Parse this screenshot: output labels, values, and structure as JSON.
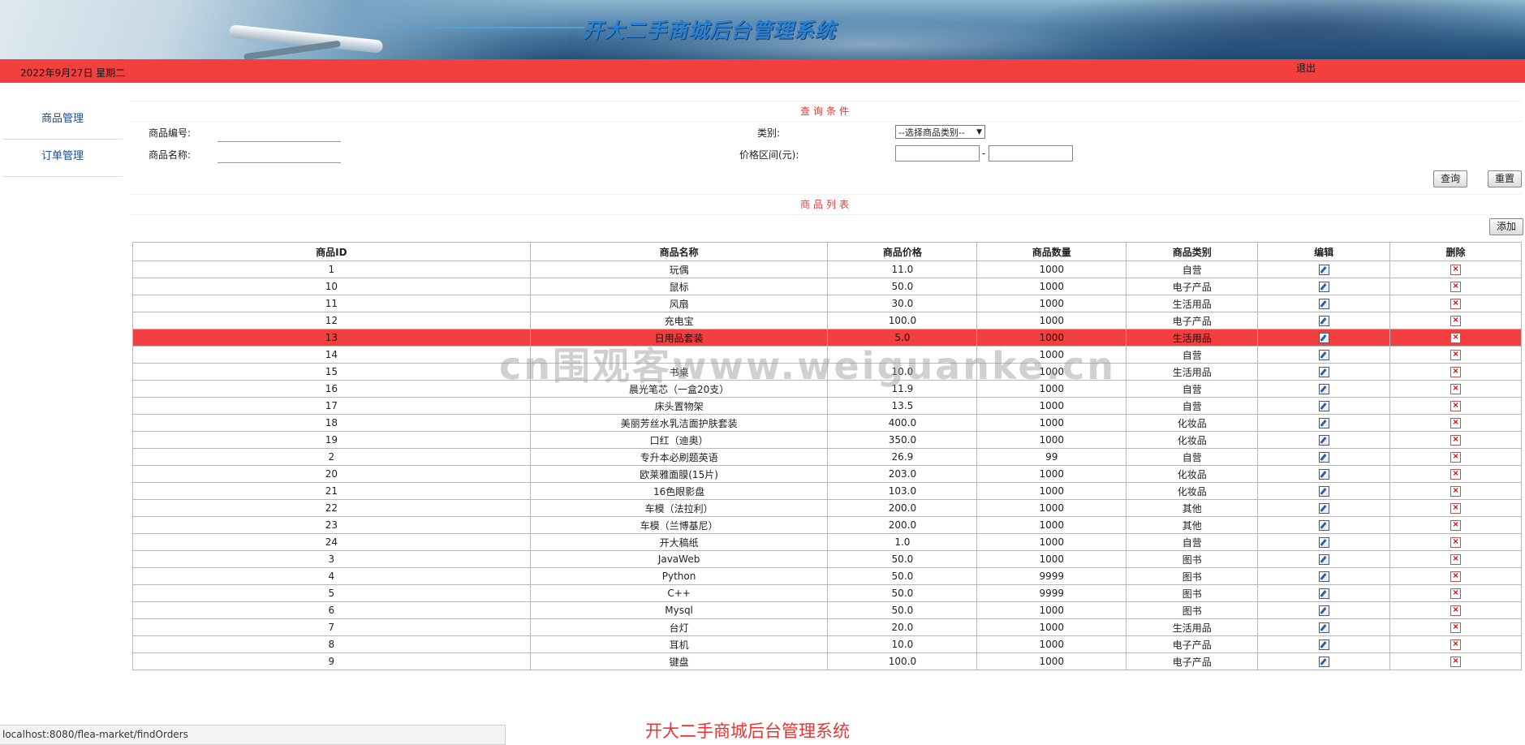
{
  "header": {
    "title": "开大二手商城后台管理系统",
    "date": "2022年9月27日 星期二",
    "logout_label": "退出"
  },
  "sidebar": {
    "items": [
      {
        "label": "商品管理"
      },
      {
        "label": "订单管理"
      }
    ]
  },
  "query": {
    "section_title": "查询条件",
    "id_label": "商品编号:",
    "name_label": "商品名称:",
    "category_label": "类别:",
    "category_selected": "--选择商品类别--",
    "price_label": "价格区间(元):",
    "price_separator": "-",
    "search_label": "查询",
    "reset_label": "重置"
  },
  "list": {
    "section_title": "商品列表",
    "add_label": "添加",
    "columns": [
      "商品ID",
      "商品名称",
      "商品价格",
      "商品数量",
      "商品类别",
      "编辑",
      "删除"
    ],
    "highlighted_row": 4,
    "rows": [
      {
        "id": "1",
        "name": "玩偶",
        "price": "11.0",
        "qty": "1000",
        "category": "自营"
      },
      {
        "id": "10",
        "name": "鼠标",
        "price": "50.0",
        "qty": "1000",
        "category": "电子产品"
      },
      {
        "id": "11",
        "name": "风扇",
        "price": "30.0",
        "qty": "1000",
        "category": "生活用品"
      },
      {
        "id": "12",
        "name": "充电宝",
        "price": "100.0",
        "qty": "1000",
        "category": "电子产品"
      },
      {
        "id": "13",
        "name": "日用品套装",
        "price": "5.0",
        "qty": "1000",
        "category": "生活用品"
      },
      {
        "id": "14",
        "name": "",
        "price": "",
        "qty": "1000",
        "category": "自营"
      },
      {
        "id": "15",
        "name": "书桌",
        "price": "10.0",
        "qty": "1000",
        "category": "生活用品"
      },
      {
        "id": "16",
        "name": "晨光笔芯（一盒20支）",
        "price": "11.9",
        "qty": "1000",
        "category": "自营"
      },
      {
        "id": "17",
        "name": "床头置物架",
        "price": "13.5",
        "qty": "1000",
        "category": "自营"
      },
      {
        "id": "18",
        "name": "美丽芳丝水乳洁面护肤套装",
        "price": "400.0",
        "qty": "1000",
        "category": "化妆品"
      },
      {
        "id": "19",
        "name": "口红（迪奥）",
        "price": "350.0",
        "qty": "1000",
        "category": "化妆品"
      },
      {
        "id": "2",
        "name": "专升本必刷题英语",
        "price": "26.9",
        "qty": "99",
        "category": "自营"
      },
      {
        "id": "20",
        "name": "欧莱雅面膜(15片)",
        "price": "203.0",
        "qty": "1000",
        "category": "化妆品"
      },
      {
        "id": "21",
        "name": "16色眼影盘",
        "price": "103.0",
        "qty": "1000",
        "category": "化妆品"
      },
      {
        "id": "22",
        "name": "车模（法拉利）",
        "price": "200.0",
        "qty": "1000",
        "category": "其他"
      },
      {
        "id": "23",
        "name": "车模（兰博基尼）",
        "price": "200.0",
        "qty": "1000",
        "category": "其他"
      },
      {
        "id": "24",
        "name": "开大稿纸",
        "price": "1.0",
        "qty": "1000",
        "category": "自营"
      },
      {
        "id": "3",
        "name": "JavaWeb",
        "price": "50.0",
        "qty": "1000",
        "category": "图书"
      },
      {
        "id": "4",
        "name": "Python",
        "price": "50.0",
        "qty": "9999",
        "category": "图书"
      },
      {
        "id": "5",
        "name": "C++",
        "price": "50.0",
        "qty": "9999",
        "category": "图书"
      },
      {
        "id": "6",
        "name": "Mysql",
        "price": "50.0",
        "qty": "1000",
        "category": "图书"
      },
      {
        "id": "7",
        "name": "台灯",
        "price": "20.0",
        "qty": "1000",
        "category": "生活用品"
      },
      {
        "id": "8",
        "name": "耳机",
        "price": "10.0",
        "qty": "1000",
        "category": "电子产品"
      },
      {
        "id": "9",
        "name": "键盘",
        "price": "100.0",
        "qty": "1000",
        "category": "电子产品"
      }
    ]
  },
  "watermark": "cn围观客www.weiguanke.cn",
  "statusbar": {
    "url": "localhost:8080/flea-market/findOrders"
  },
  "footer": {
    "text": "开大二手商城后台管理系统"
  },
  "colors": {
    "accent_red": "#f43f3f",
    "link_blue": "#1f4a86",
    "banner_title": "#2a7fd0"
  }
}
